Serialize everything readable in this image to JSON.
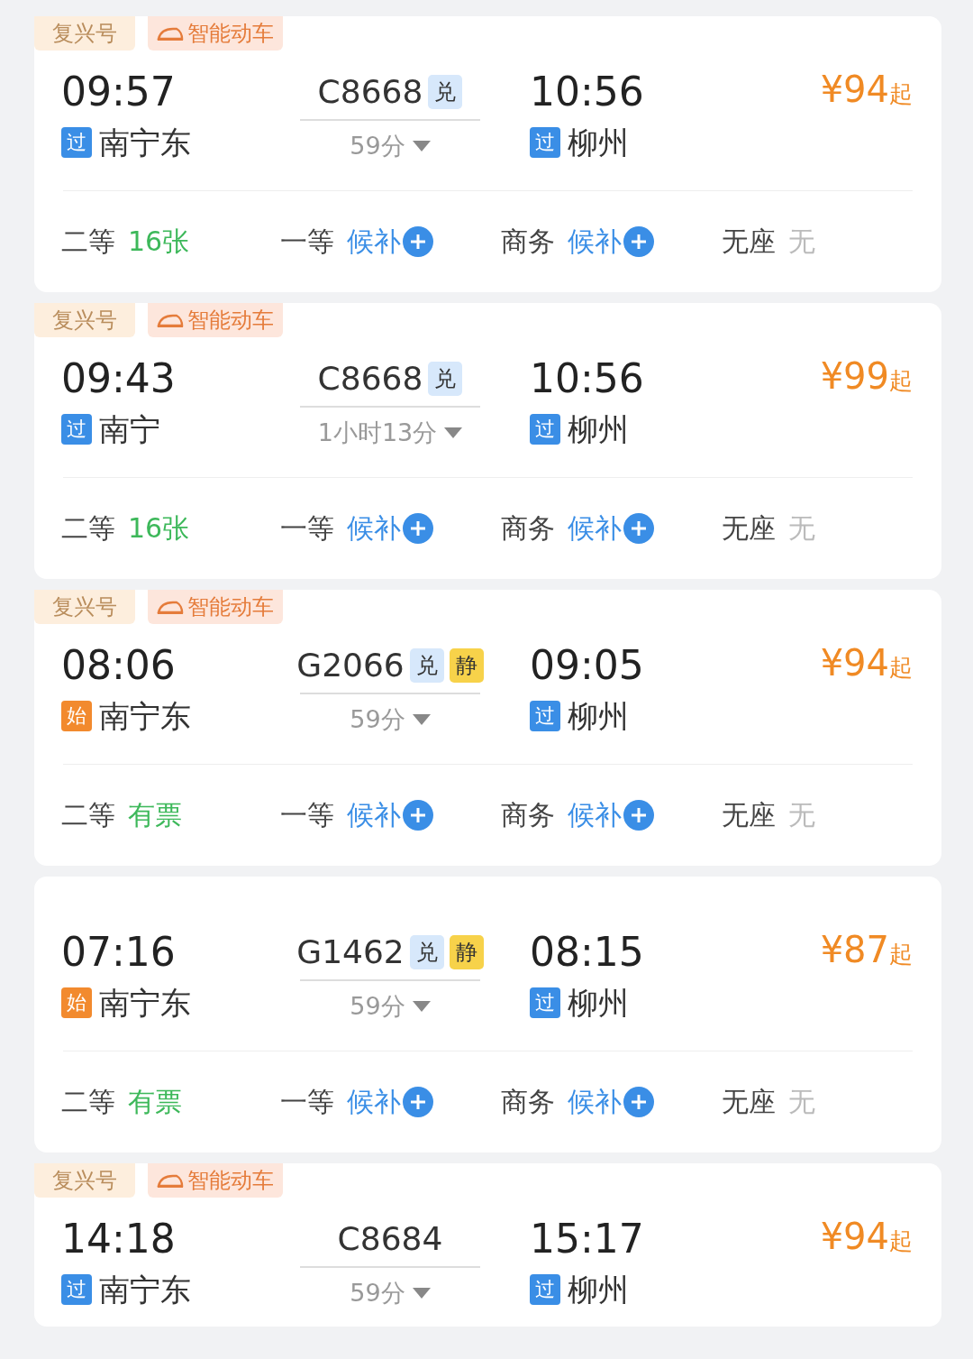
{
  "trains": [
    {
      "tags": [
        {
          "kind": "brand",
          "text": "复兴号"
        },
        {
          "kind": "smart",
          "text": "智能动车"
        }
      ],
      "depart_time": "09:57",
      "depart_station": {
        "kind": "pass",
        "badge": "过",
        "name": "南宁东"
      },
      "train_no": "C8668",
      "badges": [
        {
          "kind": "exchange",
          "text": "兑"
        }
      ],
      "duration": "59分",
      "arrive_time": "10:56",
      "arrive_station": {
        "kind": "pass",
        "badge": "过",
        "name": "柳州"
      },
      "price": "¥94",
      "price_suffix": "起",
      "seats": [
        {
          "class": "二等",
          "kind": "count",
          "status": "16张"
        },
        {
          "class": "一等",
          "kind": "waitlist",
          "status": "候补"
        },
        {
          "class": "商务",
          "kind": "waitlist",
          "status": "候补"
        },
        {
          "class": "无座",
          "kind": "none",
          "status": "无"
        }
      ]
    },
    {
      "tags": [
        {
          "kind": "brand",
          "text": "复兴号"
        },
        {
          "kind": "smart",
          "text": "智能动车"
        }
      ],
      "depart_time": "09:43",
      "depart_station": {
        "kind": "pass",
        "badge": "过",
        "name": "南宁"
      },
      "train_no": "C8668",
      "badges": [
        {
          "kind": "exchange",
          "text": "兑"
        }
      ],
      "duration": "1小时13分",
      "arrive_time": "10:56",
      "arrive_station": {
        "kind": "pass",
        "badge": "过",
        "name": "柳州"
      },
      "price": "¥99",
      "price_suffix": "起",
      "seats": [
        {
          "class": "二等",
          "kind": "count",
          "status": "16张"
        },
        {
          "class": "一等",
          "kind": "waitlist",
          "status": "候补"
        },
        {
          "class": "商务",
          "kind": "waitlist",
          "status": "候补"
        },
        {
          "class": "无座",
          "kind": "none",
          "status": "无"
        }
      ]
    },
    {
      "tags": [
        {
          "kind": "brand",
          "text": "复兴号"
        },
        {
          "kind": "smart",
          "text": "智能动车"
        }
      ],
      "depart_time": "08:06",
      "depart_station": {
        "kind": "start",
        "badge": "始",
        "name": "南宁东"
      },
      "train_no": "G2066",
      "badges": [
        {
          "kind": "exchange",
          "text": "兑"
        },
        {
          "kind": "quiet",
          "text": "静"
        }
      ],
      "duration": "59分",
      "arrive_time": "09:05",
      "arrive_station": {
        "kind": "pass",
        "badge": "过",
        "name": "柳州"
      },
      "price": "¥94",
      "price_suffix": "起",
      "seats": [
        {
          "class": "二等",
          "kind": "count",
          "status": "有票"
        },
        {
          "class": "一等",
          "kind": "waitlist",
          "status": "候补"
        },
        {
          "class": "商务",
          "kind": "waitlist",
          "status": "候补"
        },
        {
          "class": "无座",
          "kind": "none",
          "status": "无"
        }
      ]
    },
    {
      "depart_time": "07:16",
      "depart_station": {
        "kind": "start",
        "badge": "始",
        "name": "南宁东"
      },
      "train_no": "G1462",
      "badges": [
        {
          "kind": "exchange",
          "text": "兑"
        },
        {
          "kind": "quiet",
          "text": "静"
        }
      ],
      "duration": "59分",
      "arrive_time": "08:15",
      "arrive_station": {
        "kind": "pass",
        "badge": "过",
        "name": "柳州"
      },
      "price": "¥87",
      "price_suffix": "起",
      "seats": [
        {
          "class": "二等",
          "kind": "count",
          "status": "有票"
        },
        {
          "class": "一等",
          "kind": "waitlist",
          "status": "候补"
        },
        {
          "class": "商务",
          "kind": "waitlist",
          "status": "候补"
        },
        {
          "class": "无座",
          "kind": "none",
          "status": "无"
        }
      ]
    },
    {
      "tags": [
        {
          "kind": "brand",
          "text": "复兴号"
        },
        {
          "kind": "smart",
          "text": "智能动车"
        }
      ],
      "depart_time": "14:18",
      "depart_station": {
        "kind": "pass",
        "badge": "过",
        "name": "南宁东"
      },
      "train_no": "C8684",
      "duration": "59分",
      "arrive_time": "15:17",
      "arrive_station": {
        "kind": "pass",
        "badge": "过",
        "name": "柳州"
      },
      "price": "¥94",
      "price_suffix": "起"
    }
  ]
}
